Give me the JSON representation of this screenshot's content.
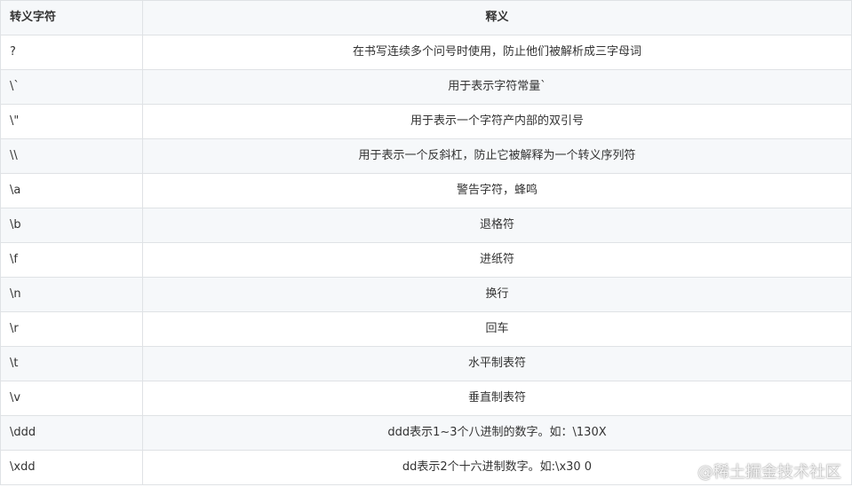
{
  "table": {
    "headers": [
      "转义字符",
      "释义"
    ],
    "rows": [
      {
        "key": "?",
        "value": "在书写连续多个问号时使用，防止他们被解析成三字母词"
      },
      {
        "key": "\\`",
        "value": "用于表示字符常量`"
      },
      {
        "key": "\\\"",
        "value": "用于表示一个字符产内部的双引号"
      },
      {
        "key": "\\\\",
        "value": "用于表示一个反斜杠，防止它被解释为一个转义序列符"
      },
      {
        "key": "\\a",
        "value": "警告字符，蜂鸣"
      },
      {
        "key": "\\b",
        "value": "退格符"
      },
      {
        "key": "\\f",
        "value": "进纸符"
      },
      {
        "key": "\\n",
        "value": "换行"
      },
      {
        "key": "\\r",
        "value": "回车"
      },
      {
        "key": "\\t",
        "value": "水平制表符"
      },
      {
        "key": "\\v",
        "value": "垂直制表符"
      },
      {
        "key": "\\ddd",
        "value": "ddd表示1~3个八进制的数字。如：\\130X"
      },
      {
        "key": "\\xdd",
        "value": "dd表示2个十六进制数字。如:\\x30 0"
      }
    ]
  },
  "watermark": "@稀土掘金技术社区",
  "colors": {
    "header_bg": "#f6f8fa",
    "border": "#dfe2e5",
    "text": "#333333",
    "stripe_bg": "#f6f8fa"
  }
}
